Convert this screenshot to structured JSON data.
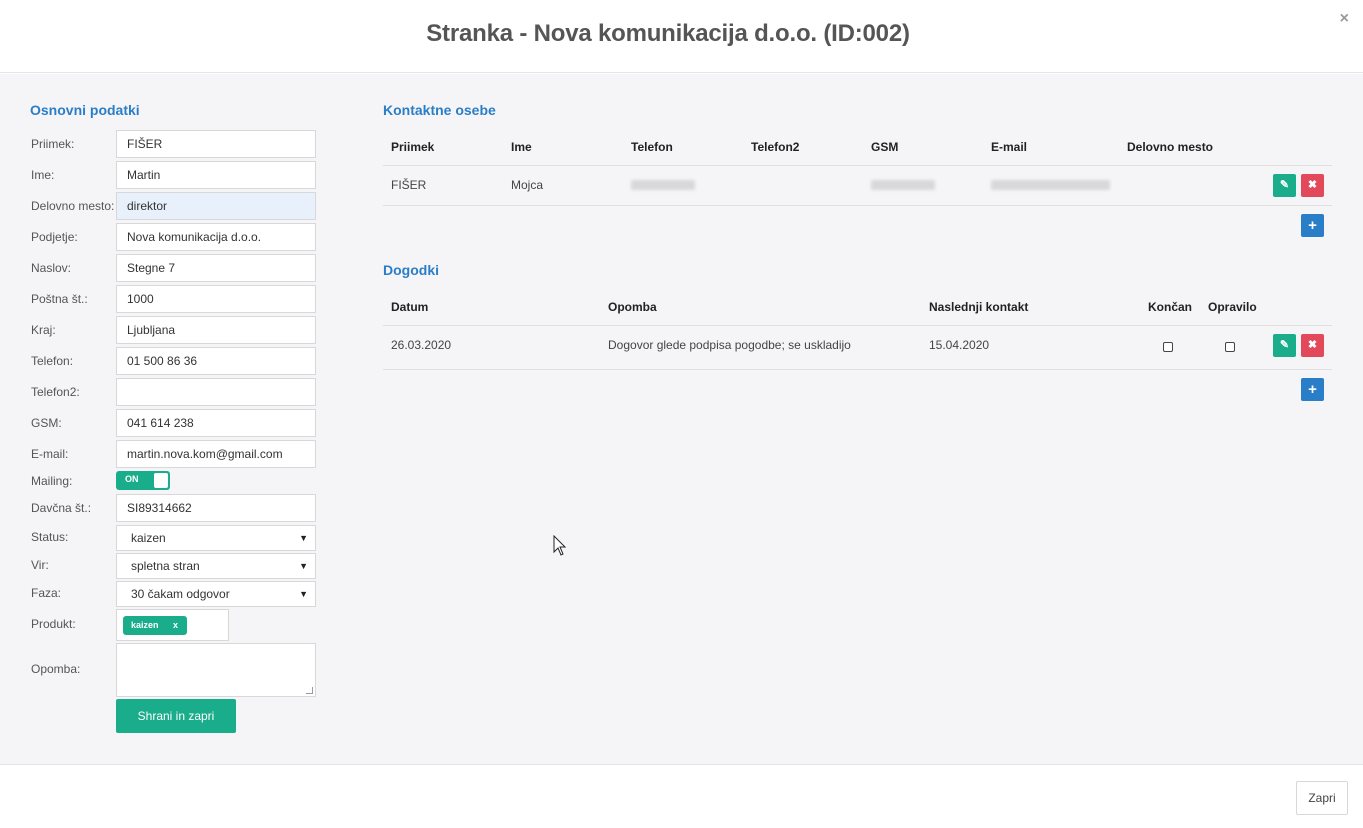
{
  "header": {
    "title": "Stranka - Nova komunikacija d.o.o. (ID:002)",
    "close_glyph": "×"
  },
  "basic": {
    "title": "Osnovni podatki",
    "labels": {
      "surname": "Priimek:",
      "name": "Ime:",
      "position": "Delovno mesto:",
      "company": "Podjetje:",
      "address": "Naslov:",
      "postal": "Poštna št.:",
      "city": "Kraj:",
      "phone": "Telefon:",
      "phone2": "Telefon2:",
      "gsm": "GSM:",
      "email": "E-mail:",
      "mailing": "Mailing:",
      "tax": "Davčna št.:",
      "status": "Status:",
      "source": "Vir:",
      "phase": "Faza:",
      "product": "Produkt:",
      "note": "Opomba:"
    },
    "values": {
      "surname": "FIŠER",
      "name": "Martin",
      "position": "direktor",
      "company": "Nova komunikacija d.o.o.",
      "address": "Stegne 7",
      "postal": "1000",
      "city": "Ljubljana",
      "phone": "01 500 86 36",
      "phone2": "",
      "gsm": "041 614 238",
      "email": "martin.nova.kom@gmail.com",
      "tax": "SI89314662",
      "status": "kaizen",
      "source": "spletna stran",
      "phase": "30 čakam odgovor",
      "note": ""
    },
    "mailing_toggle": "ON",
    "product_tag": {
      "label": "kaizen",
      "remove": "x"
    },
    "save_label": "Shrani in zapri"
  },
  "contacts": {
    "title": "Kontaktne osebe",
    "headers": [
      "Priimek",
      "Ime",
      "Telefon",
      "Telefon2",
      "GSM",
      "E-mail",
      "Delovno mesto"
    ],
    "rows": [
      {
        "surname": "FIŠER",
        "name": "Mojca"
      }
    ]
  },
  "events": {
    "title": "Dogodki",
    "headers": [
      "Datum",
      "Opomba",
      "Naslednji kontakt",
      "Končan",
      "Opravilo"
    ],
    "rows": [
      {
        "date": "26.03.2020",
        "note": "Dogovor glede podpisa pogodbe; se uskladijo",
        "next": "15.04.2020"
      }
    ]
  },
  "footer": {
    "close_label": "Zapri"
  },
  "colors": {
    "accent_green": "#1aad8b",
    "accent_blue": "#2a7ec7",
    "danger_red": "#e2495a"
  },
  "icons": {
    "edit": "pencil-icon",
    "delete": "times-icon",
    "add": "plus-icon"
  }
}
